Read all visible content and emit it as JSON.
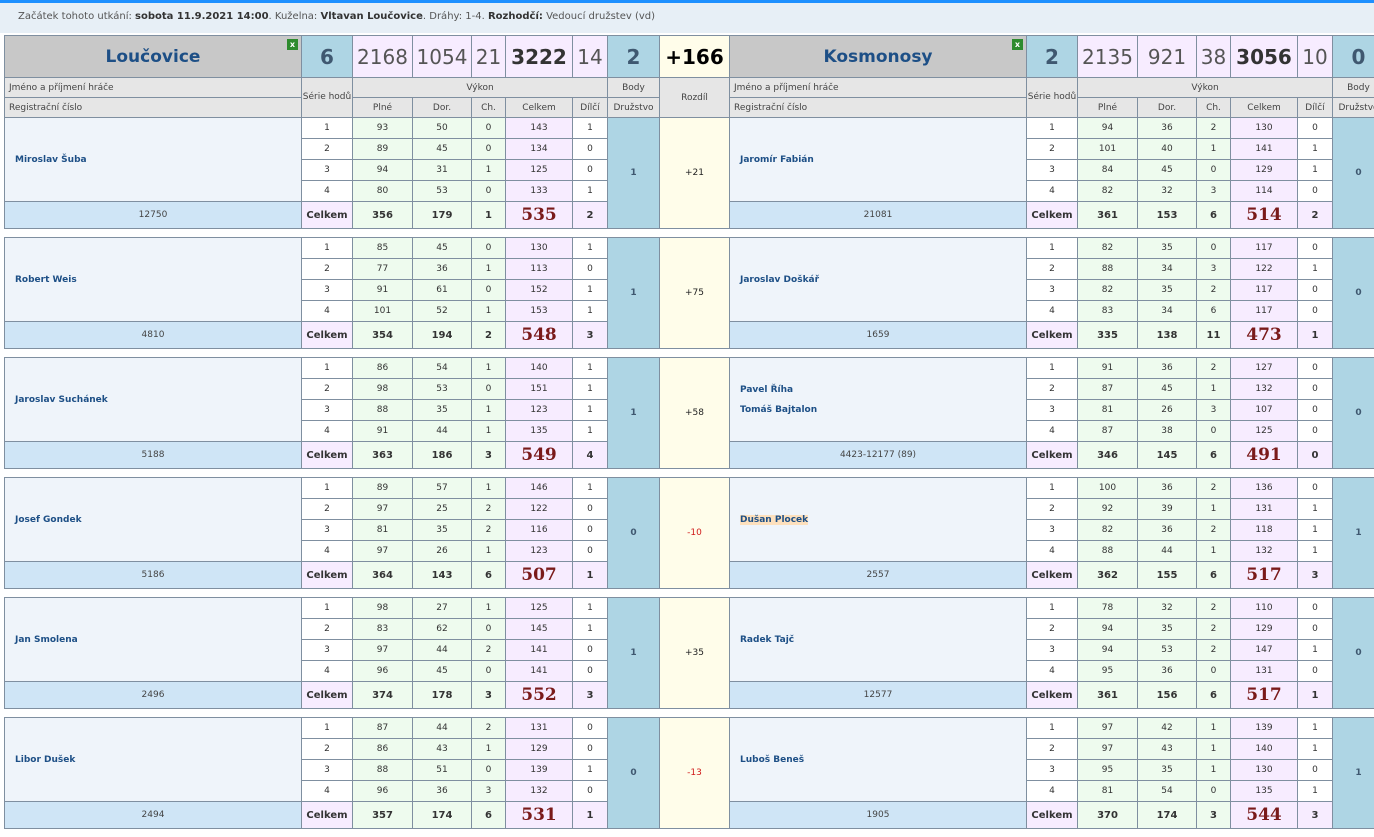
{
  "info": {
    "start_label": "Začátek tohoto utkání:",
    "start_value": "sobota 11.9.2021 14:00",
    "venue_label": "Kuželna:",
    "venue_value": "Vltavan Loučovice",
    "lanes_label": "Dráhy:",
    "lanes_value": "1-4.",
    "referee_label": "Rozhodčí:",
    "referee_value": "Vedoucí družstev (vd)"
  },
  "home": {
    "team": "Loučovice",
    "sets": "6",
    "full": "2168",
    "clear": "1054",
    "errors": "21",
    "total": "3222",
    "partial": "14",
    "points": "2"
  },
  "away": {
    "team": "Kosmonosy",
    "sets": "2",
    "full": "2135",
    "clear": "921",
    "errors": "38",
    "total": "3056",
    "partial": "10",
    "points": "0"
  },
  "diff_total": "+166",
  "headers": {
    "name": "Jméno a příjmení hráče",
    "reg": "Registrační číslo",
    "series": "Série hodů",
    "perf": "Výkon",
    "full": "Plné",
    "clear": "Dor.",
    "errors": "Ch.",
    "total": "Celkem",
    "partial": "Dílčí",
    "points": "Body",
    "team": "Družstvo",
    "diff": "Rozdíl",
    "total_row": "Celkem",
    "close_icon": "x"
  },
  "matches": [
    {
      "diff": "+21",
      "home": {
        "name": "Miroslav Šuba",
        "reg": "12750",
        "body": "1",
        "rows": [
          [
            "1",
            "93",
            "50",
            "0",
            "143",
            "1"
          ],
          [
            "2",
            "89",
            "45",
            "0",
            "134",
            "0"
          ],
          [
            "3",
            "94",
            "31",
            "1",
            "125",
            "0"
          ],
          [
            "4",
            "80",
            "53",
            "0",
            "133",
            "1"
          ]
        ],
        "tot": [
          "356",
          "179",
          "1",
          "535",
          "2"
        ]
      },
      "away": {
        "name": "Jaromír Fabián",
        "reg": "21081",
        "body": "0",
        "rows": [
          [
            "1",
            "94",
            "36",
            "2",
            "130",
            "0"
          ],
          [
            "2",
            "101",
            "40",
            "1",
            "141",
            "1"
          ],
          [
            "3",
            "84",
            "45",
            "0",
            "129",
            "1"
          ],
          [
            "4",
            "82",
            "32",
            "3",
            "114",
            "0"
          ]
        ],
        "tot": [
          "361",
          "153",
          "6",
          "514",
          "2"
        ]
      }
    },
    {
      "diff": "+75",
      "home": {
        "name": "Robert Weis",
        "reg": "4810",
        "body": "1",
        "rows": [
          [
            "1",
            "85",
            "45",
            "0",
            "130",
            "1"
          ],
          [
            "2",
            "77",
            "36",
            "1",
            "113",
            "0"
          ],
          [
            "3",
            "91",
            "61",
            "0",
            "152",
            "1"
          ],
          [
            "4",
            "101",
            "52",
            "1",
            "153",
            "1"
          ]
        ],
        "tot": [
          "354",
          "194",
          "2",
          "548",
          "3"
        ]
      },
      "away": {
        "name": "Jaroslav Doškář",
        "reg": "1659",
        "body": "0",
        "rows": [
          [
            "1",
            "82",
            "35",
            "0",
            "117",
            "0"
          ],
          [
            "2",
            "88",
            "34",
            "3",
            "122",
            "1"
          ],
          [
            "3",
            "82",
            "35",
            "2",
            "117",
            "0"
          ],
          [
            "4",
            "83",
            "34",
            "6",
            "117",
            "0"
          ]
        ],
        "tot": [
          "335",
          "138",
          "11",
          "473",
          "1"
        ]
      }
    },
    {
      "diff": "+58",
      "home": {
        "name": "Jaroslav Suchánek",
        "reg": "5188",
        "body": "1",
        "rows": [
          [
            "1",
            "86",
            "54",
            "1",
            "140",
            "1"
          ],
          [
            "2",
            "98",
            "53",
            "0",
            "151",
            "1"
          ],
          [
            "3",
            "88",
            "35",
            "1",
            "123",
            "1"
          ],
          [
            "4",
            "91",
            "44",
            "1",
            "135",
            "1"
          ]
        ],
        "tot": [
          "363",
          "186",
          "3",
          "549",
          "4"
        ]
      },
      "away": {
        "name": "Pavel Říha",
        "name2": "Tomáš Bajtalon",
        "reg": "4423-12177 (89)",
        "body": "0",
        "rows": [
          [
            "1",
            "91",
            "36",
            "2",
            "127",
            "0"
          ],
          [
            "2",
            "87",
            "45",
            "1",
            "132",
            "0"
          ],
          [
            "3",
            "81",
            "26",
            "3",
            "107",
            "0"
          ],
          [
            "4",
            "87",
            "38",
            "0",
            "125",
            "0"
          ]
        ],
        "tot": [
          "346",
          "145",
          "6",
          "491",
          "0"
        ]
      }
    },
    {
      "diff": "-10",
      "home": {
        "name": "Josef Gondek",
        "reg": "5186",
        "body": "0",
        "rows": [
          [
            "1",
            "89",
            "57",
            "1",
            "146",
            "1"
          ],
          [
            "2",
            "97",
            "25",
            "2",
            "122",
            "0"
          ],
          [
            "3",
            "81",
            "35",
            "2",
            "116",
            "0"
          ],
          [
            "4",
            "97",
            "26",
            "1",
            "123",
            "0"
          ]
        ],
        "tot": [
          "364",
          "143",
          "6",
          "507",
          "1"
        ]
      },
      "away": {
        "name": "Dušan Plocek",
        "highlight": true,
        "reg": "2557",
        "body": "1",
        "rows": [
          [
            "1",
            "100",
            "36",
            "2",
            "136",
            "0"
          ],
          [
            "2",
            "92",
            "39",
            "1",
            "131",
            "1"
          ],
          [
            "3",
            "82",
            "36",
            "2",
            "118",
            "1"
          ],
          [
            "4",
            "88",
            "44",
            "1",
            "132",
            "1"
          ]
        ],
        "tot": [
          "362",
          "155",
          "6",
          "517",
          "3"
        ]
      }
    },
    {
      "diff": "+35",
      "home": {
        "name": "Jan Smolena",
        "reg": "2496",
        "body": "1",
        "rows": [
          [
            "1",
            "98",
            "27",
            "1",
            "125",
            "1"
          ],
          [
            "2",
            "83",
            "62",
            "0",
            "145",
            "1"
          ],
          [
            "3",
            "97",
            "44",
            "2",
            "141",
            "0"
          ],
          [
            "4",
            "96",
            "45",
            "0",
            "141",
            "0"
          ]
        ],
        "tot": [
          "374",
          "178",
          "3",
          "552",
          "3"
        ]
      },
      "away": {
        "name": "Radek Tajč",
        "reg": "12577",
        "body": "0",
        "rows": [
          [
            "1",
            "78",
            "32",
            "2",
            "110",
            "0"
          ],
          [
            "2",
            "94",
            "35",
            "2",
            "129",
            "0"
          ],
          [
            "3",
            "94",
            "53",
            "2",
            "147",
            "1"
          ],
          [
            "4",
            "95",
            "36",
            "0",
            "131",
            "0"
          ]
        ],
        "tot": [
          "361",
          "156",
          "6",
          "517",
          "1"
        ]
      }
    },
    {
      "diff": "-13",
      "home": {
        "name": "Libor Dušek",
        "reg": "2494",
        "body": "0",
        "rows": [
          [
            "1",
            "87",
            "44",
            "2",
            "131",
            "0"
          ],
          [
            "2",
            "86",
            "43",
            "1",
            "129",
            "0"
          ],
          [
            "3",
            "88",
            "51",
            "0",
            "139",
            "1"
          ],
          [
            "4",
            "96",
            "36",
            "3",
            "132",
            "0"
          ]
        ],
        "tot": [
          "357",
          "174",
          "6",
          "531",
          "1"
        ]
      },
      "away": {
        "name": "Luboš Beneš",
        "reg": "1905",
        "body": "1",
        "rows": [
          [
            "1",
            "97",
            "42",
            "1",
            "139",
            "1"
          ],
          [
            "2",
            "97",
            "43",
            "1",
            "140",
            "1"
          ],
          [
            "3",
            "95",
            "35",
            "1",
            "130",
            "0"
          ],
          [
            "4",
            "81",
            "54",
            "0",
            "135",
            "1"
          ]
        ],
        "tot": [
          "370",
          "174",
          "3",
          "544",
          "3"
        ]
      }
    }
  ]
}
